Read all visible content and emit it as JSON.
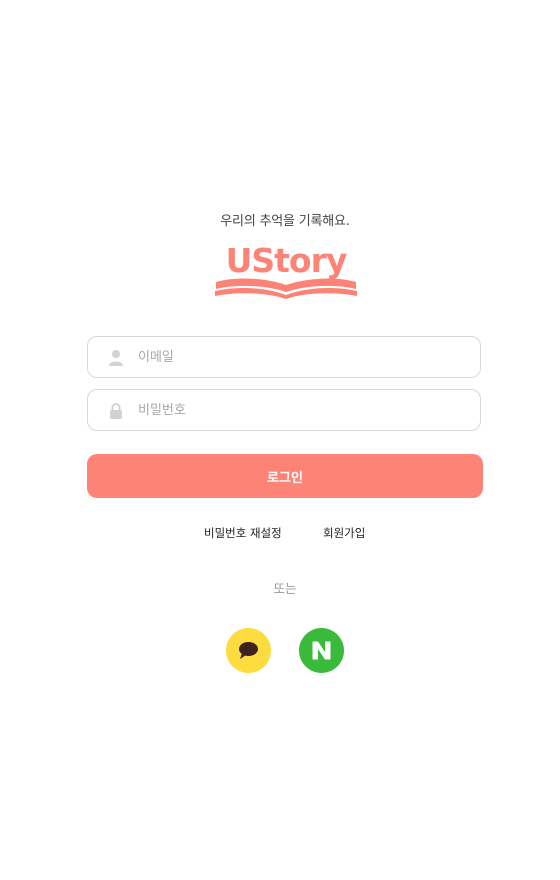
{
  "header": {
    "tagline": "우리의 추억을 기록해요.",
    "logo_text": "UStory"
  },
  "form": {
    "email_placeholder": "이메일",
    "email_value": "",
    "password_placeholder": "비밀번호",
    "password_value": "",
    "login_label": "로그인"
  },
  "links": {
    "reset_password": "비밀번호 재설정",
    "signup": "회원가입"
  },
  "divider_text": "또는",
  "social": [
    {
      "provider": "kakao",
      "icon": "speech-bubble-icon",
      "color": "#fcdc3f",
      "glyph_color": "#3d2220"
    },
    {
      "provider": "naver",
      "icon": "naver-n-icon",
      "color": "#3aba3a",
      "glyph_color": "#ffffff"
    }
  ],
  "colors": {
    "accent": "#fe8377",
    "input_border": "#d8d8d8",
    "icon_gray": "#d2d2d2"
  }
}
